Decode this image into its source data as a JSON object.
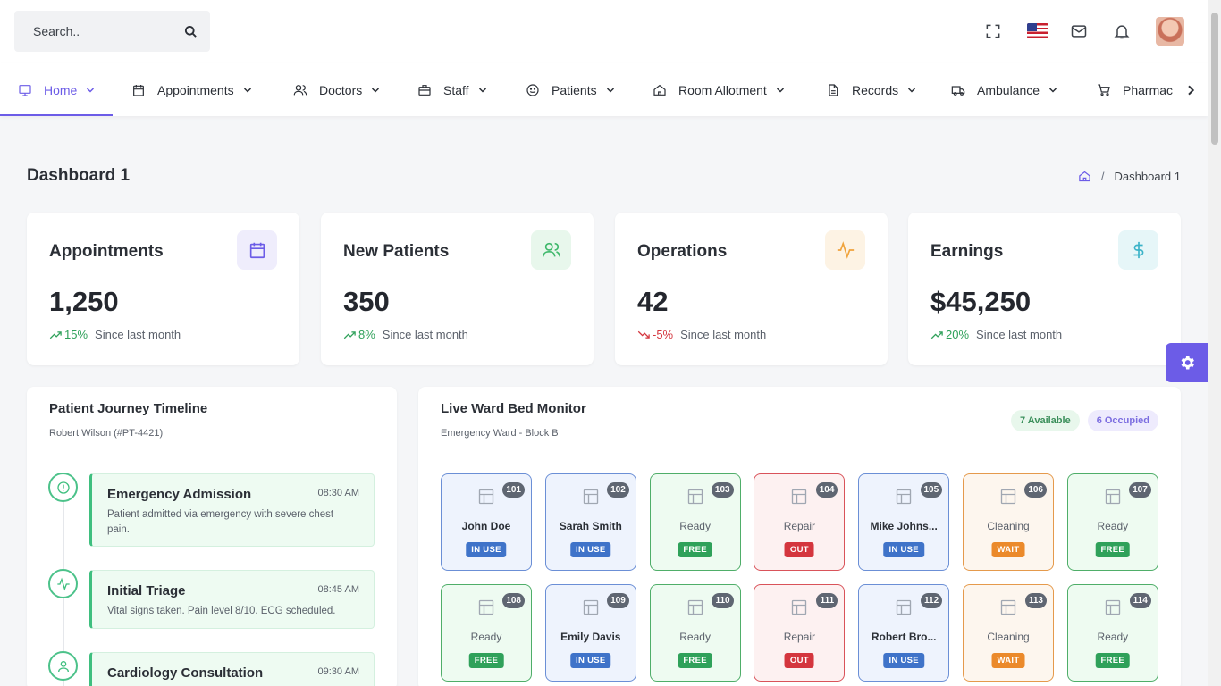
{
  "search": {
    "placeholder": "Search.."
  },
  "header_icons": [
    "fullscreen-icon",
    "us-flag-icon",
    "mail-icon",
    "bell-icon",
    "user-avatar"
  ],
  "nav": {
    "items": [
      {
        "label": "Home",
        "icon": "monitor-icon",
        "active": true
      },
      {
        "label": "Appointments",
        "icon": "calendar-icon"
      },
      {
        "label": "Doctors",
        "icon": "users-icon"
      },
      {
        "label": "Staff",
        "icon": "briefcase-icon"
      },
      {
        "label": "Patients",
        "icon": "smile-icon"
      },
      {
        "label": "Room Allotment",
        "icon": "home-icon"
      },
      {
        "label": "Records",
        "icon": "file-icon"
      },
      {
        "label": "Ambulance",
        "icon": "truck-icon"
      },
      {
        "label": "Pharmac",
        "icon": "cart-icon"
      }
    ]
  },
  "page": {
    "title": "Dashboard 1",
    "breadcrumb": [
      "Dashboard 1"
    ]
  },
  "stats": [
    {
      "title": "Appointments",
      "value": "1,250",
      "pct": "15%",
      "trend": "up",
      "since": "Since last month",
      "icon": "calendar-icon",
      "color": "#6c5ce7",
      "bg": "#efedfc"
    },
    {
      "title": "New Patients",
      "value": "350",
      "pct": "8%",
      "trend": "up",
      "since": "Since last month",
      "icon": "users-icon",
      "color": "#3fb86b",
      "bg": "#e8f7ec"
    },
    {
      "title": "Operations",
      "value": "42",
      "pct": "-5%",
      "trend": "down",
      "since": "Since last month",
      "icon": "activity-icon",
      "color": "#f0a33c",
      "bg": "#fdf3e4"
    },
    {
      "title": "Earnings",
      "value": "$45,250",
      "pct": "20%",
      "trend": "up",
      "since": "Since last month",
      "icon": "dollar-icon",
      "color": "#3bb3c8",
      "bg": "#e6f6f8"
    }
  ],
  "timeline": {
    "title": "Patient Journey Timeline",
    "patient": "Robert Wilson (#PT-4421)",
    "events": [
      {
        "title": "Emergency Admission",
        "time": "08:30 AM",
        "desc": "Patient admitted via emergency with severe chest pain.",
        "icon": "alert-circle-icon"
      },
      {
        "title": "Initial Triage",
        "time": "08:45 AM",
        "desc": "Vital signs taken. Pain level 8/10. ECG scheduled.",
        "icon": "activity-icon"
      },
      {
        "title": "Cardiology Consultation",
        "time": "09:30 AM",
        "desc": "",
        "icon": "user-icon"
      }
    ]
  },
  "ward": {
    "title": "Live Ward Bed Monitor",
    "subtitle": "Emergency Ward - Block B",
    "available": "7 Available",
    "occupied": "6 Occupied",
    "beds": [
      {
        "num": "101",
        "label": "John Doe",
        "status": "IN USE",
        "kind": "inuse"
      },
      {
        "num": "102",
        "label": "Sarah Smith",
        "status": "IN USE",
        "kind": "inuse"
      },
      {
        "num": "103",
        "label": "Ready",
        "status": "FREE",
        "kind": "free"
      },
      {
        "num": "104",
        "label": "Repair",
        "status": "OUT",
        "kind": "out"
      },
      {
        "num": "105",
        "label": "Mike Johns...",
        "status": "IN USE",
        "kind": "inuse"
      },
      {
        "num": "106",
        "label": "Cleaning",
        "status": "WAIT",
        "kind": "wait"
      },
      {
        "num": "107",
        "label": "Ready",
        "status": "FREE",
        "kind": "free"
      },
      {
        "num": "108",
        "label": "Ready",
        "status": "FREE",
        "kind": "free"
      },
      {
        "num": "109",
        "label": "Emily Davis",
        "status": "IN USE",
        "kind": "inuse"
      },
      {
        "num": "110",
        "label": "Ready",
        "status": "FREE",
        "kind": "free"
      },
      {
        "num": "111",
        "label": "Repair",
        "status": "OUT",
        "kind": "out"
      },
      {
        "num": "112",
        "label": "Robert Bro...",
        "status": "IN USE",
        "kind": "inuse"
      },
      {
        "num": "113",
        "label": "Cleaning",
        "status": "WAIT",
        "kind": "wait"
      },
      {
        "num": "114",
        "label": "Ready",
        "status": "FREE",
        "kind": "free"
      }
    ]
  }
}
